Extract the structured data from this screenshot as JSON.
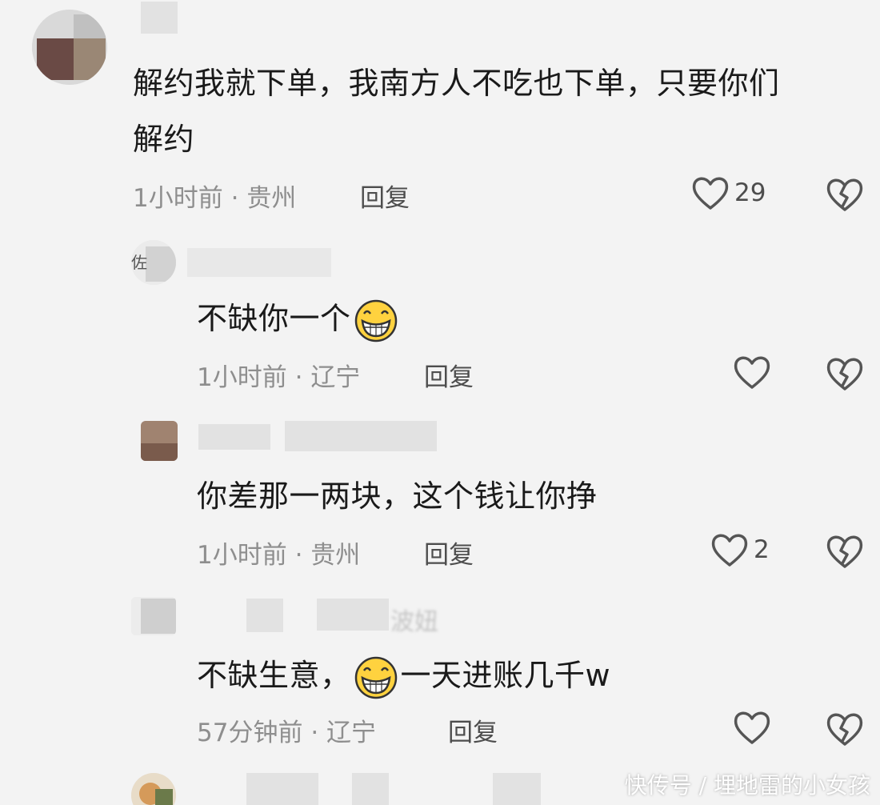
{
  "comments": [
    {
      "text_line1": "解约我就下单，我南方人不吃也下单，只要你们",
      "text_line2": "解约",
      "time": "1小时前",
      "location": "贵州",
      "reply_label": "回复",
      "likes": "29"
    },
    {
      "user_prefix": "佐",
      "text_before_emoji": "不缺你一个",
      "text_after_emoji": "",
      "time": "1小时前",
      "location": "辽宁",
      "reply_label": "回复",
      "likes": ""
    },
    {
      "text": "你差那一两块，这个钱让你挣",
      "time": "1小时前",
      "location": "贵州",
      "reply_label": "回复",
      "likes": "2"
    },
    {
      "user_suffix": "波妞",
      "text_before_emoji": "不缺生意，",
      "text_after_emoji": "一天进账几千w",
      "time": "57分钟前",
      "location": "辽宁",
      "reply_label": "回复",
      "likes": ""
    }
  ],
  "separator": "·",
  "watermark": "快传号 / 埋地雷的小女孩",
  "icons": {
    "like": "heart-outline-icon",
    "dislike": "broken-heart-icon",
    "emoji": "grinning-face-emoji"
  },
  "colors": {
    "background": "#f3f3f3",
    "text": "#1a1a1a",
    "meta": "#8e8e8e",
    "icon": "#555555"
  }
}
